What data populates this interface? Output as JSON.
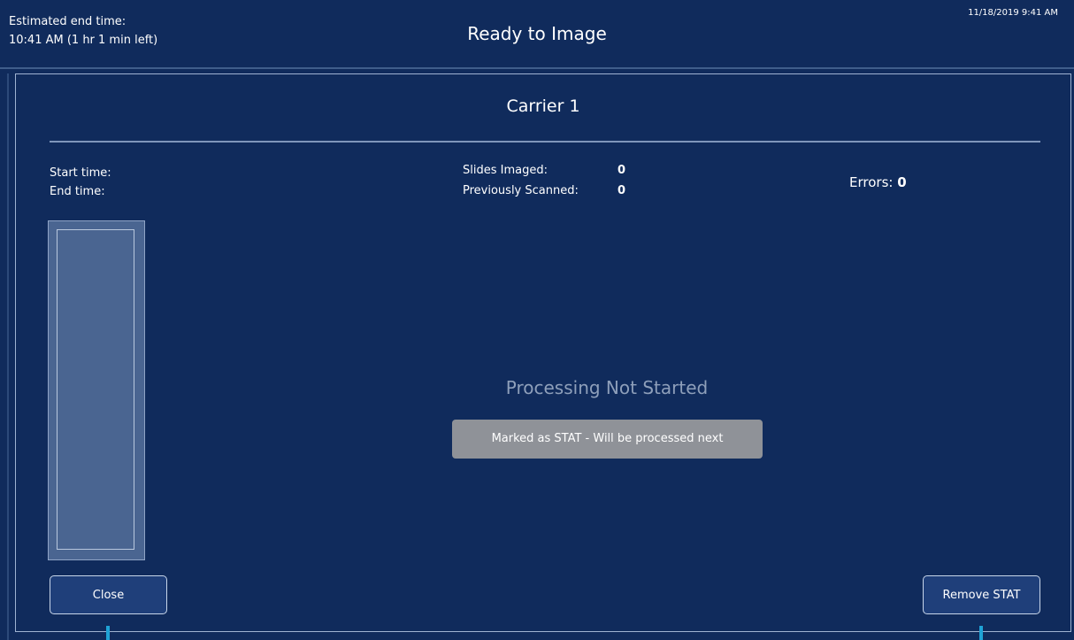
{
  "header": {
    "estimated_label": "Estimated end time:",
    "estimated_value": "10:41 AM (1 hr 1 min left)",
    "title": "Ready to Image",
    "datetime": "11/18/2019 9:41 AM"
  },
  "panel": {
    "carrier_title": "Carrier 1",
    "start_time_label": "Start time:",
    "end_time_label": "End time:",
    "slides_imaged_label": "Slides Imaged:",
    "slides_imaged_value": "0",
    "previously_scanned_label": "Previously Scanned:",
    "previously_scanned_value": "0",
    "errors_label": "Errors:",
    "errors_value": "0",
    "status_text": "Processing Not Started",
    "stat_notice": "Marked as STAT - Will be processed next"
  },
  "buttons": {
    "close_label": "Close",
    "remove_stat_label": "Remove STAT"
  },
  "colors": {
    "background": "#102b5c",
    "button": "#1f3f7a",
    "stat_notice": "#8f9298",
    "pointer": "#1fa3d6"
  }
}
